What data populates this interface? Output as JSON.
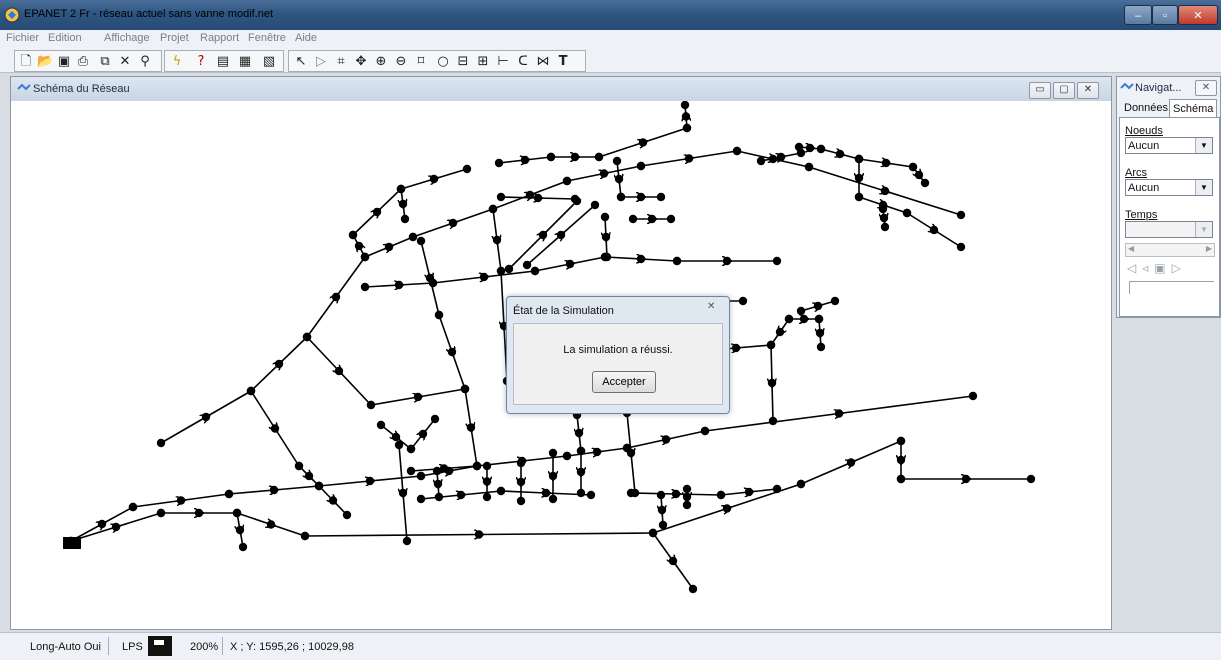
{
  "window": {
    "title": "EPANET 2 Fr - réseau actuel sans vanne modif.net"
  },
  "menu": [
    "Fichier",
    "Edition",
    "Affichage",
    "Projet",
    "Rapport",
    "Fenêtre",
    "Aide"
  ],
  "toolbar": {
    "file_icons": [
      "new-file-icon",
      "open-folder-icon",
      "save-icon",
      "print-icon",
      "copy-icon",
      "delete-icon",
      "find-icon"
    ],
    "run_icons": [
      "run-icon",
      "query-icon",
      "graph-icon",
      "table-icon",
      "options-icon"
    ],
    "map_icons": [
      "select-icon",
      "select-vertex-icon",
      "select-region-icon",
      "pan-icon",
      "zoom-in-icon",
      "zoom-out-icon",
      "full-extent-icon",
      "junction-icon",
      "reservoir-icon",
      "tank-icon",
      "pipe-icon",
      "pump-icon",
      "valve-icon",
      "label-icon"
    ],
    "label_text": "T"
  },
  "map_window": {
    "title": "Schéma du Réseau"
  },
  "dialog": {
    "title": "État de la Simulation",
    "message": "La simulation a réussi.",
    "ok_label": "Accepter"
  },
  "navigator": {
    "title": "Navigat...",
    "tabs": [
      "Données",
      "Schéma"
    ],
    "active_tab": "Schéma",
    "nodes_label": "Noeuds",
    "nodes_value": "Aucun",
    "links_label": "Arcs",
    "links_value": "Aucun",
    "time_label": "Temps",
    "time_value": ""
  },
  "status": {
    "auto_length": "Long-Auto Oui",
    "flow_units": "LPS",
    "zoom": "200%",
    "coords": "X ; Y: 1595,26 ; 10029,98"
  },
  "colors": {
    "titlebar": "#2f5683",
    "network": "#000000",
    "canvas": "#ffffff"
  }
}
